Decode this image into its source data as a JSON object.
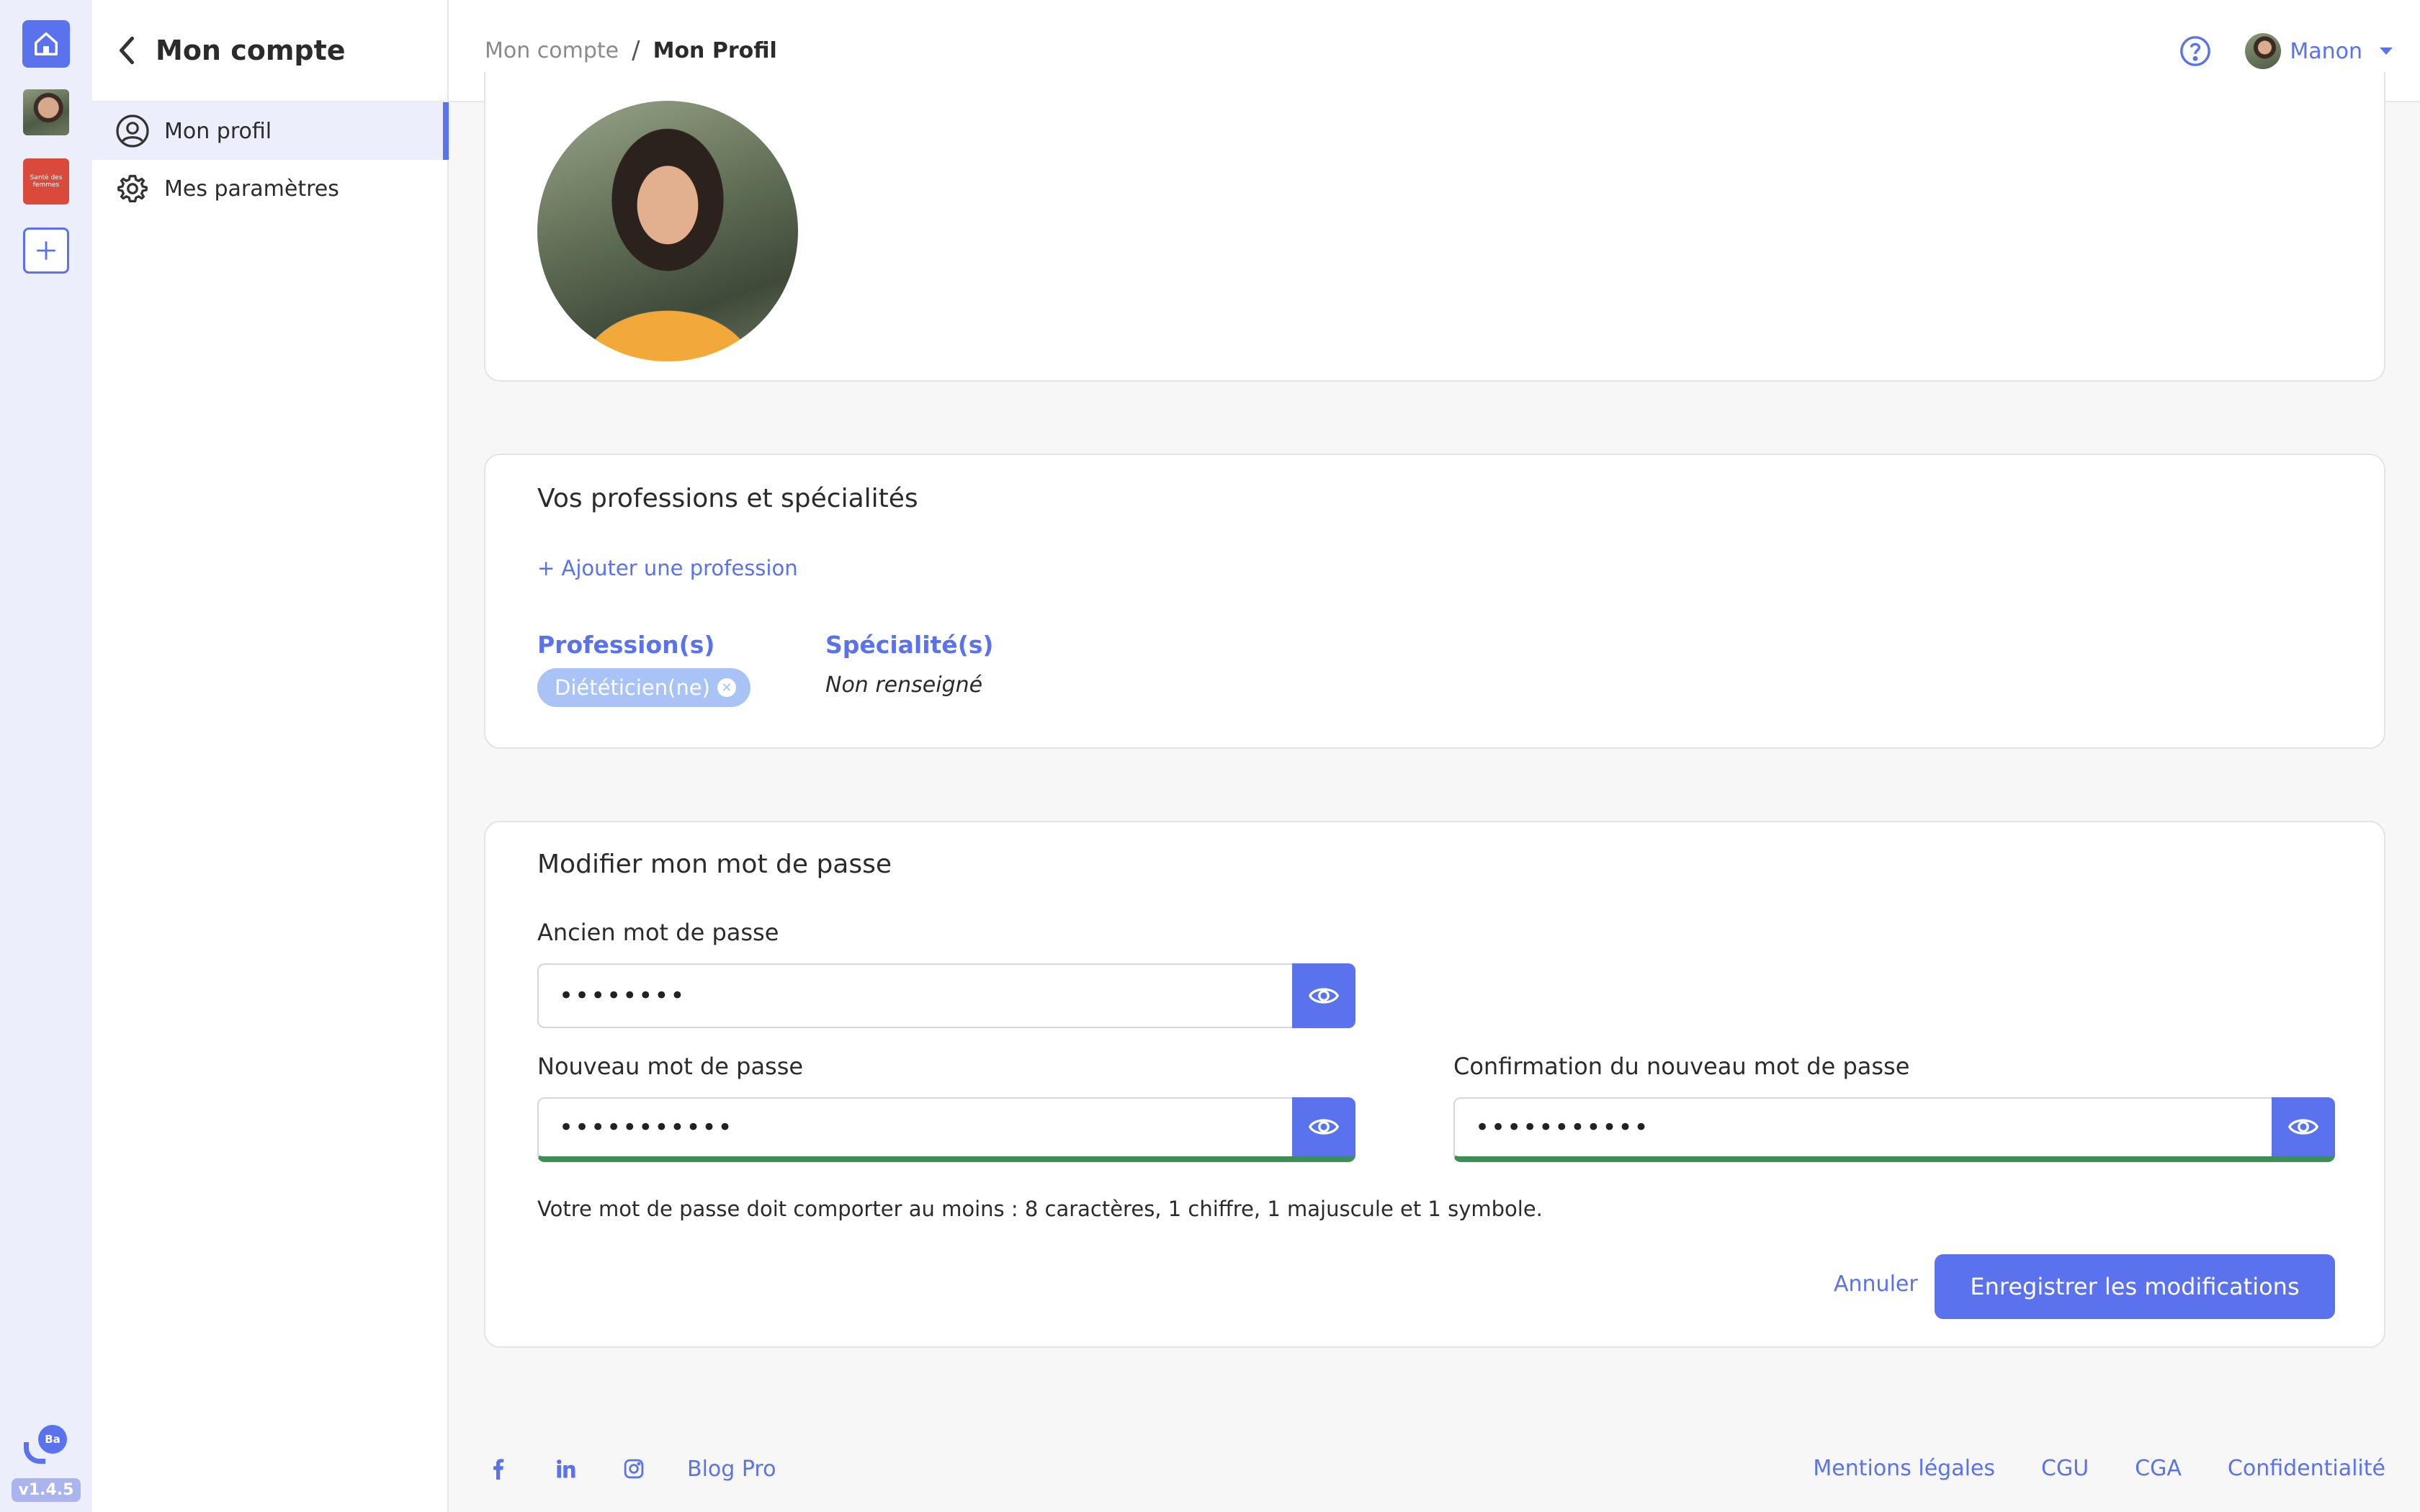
{
  "rail": {
    "brand_thumb_text": "Santé des femmes",
    "logo_text": "Ba",
    "version": "v1.4.5"
  },
  "sidebar": {
    "title": "Mon compte",
    "items": [
      {
        "label": "Mon profil",
        "icon": "user-circle-icon",
        "active": true
      },
      {
        "label": "Mes paramètres",
        "icon": "gear-icon",
        "active": false
      }
    ]
  },
  "topbar": {
    "breadcrumb_parent": "Mon compte",
    "breadcrumb_sep": "/",
    "breadcrumb_current": "Mon Profil",
    "user_name": "Manon"
  },
  "professions": {
    "title": "Vos professions et spécialités",
    "add_link": "+ Ajouter une profession",
    "profession_label": "Profession(s)",
    "profession_chip": "Diététicien(ne)",
    "specialty_label": "Spécialité(s)",
    "specialty_value": "Non renseigné"
  },
  "password": {
    "title": "Modifier mon mot de passe",
    "old_label": "Ancien mot de passe",
    "old_value": "••••••••",
    "new_label": "Nouveau mot de passe",
    "new_value": "•••••••••••",
    "confirm_label": "Confirmation du nouveau mot de passe",
    "confirm_value": "•••••••••••",
    "hint": "Votre mot de passe doit comporter au moins : 8 caractères, 1 chiffre, 1 majuscule et 1 symbole.",
    "cancel_label": "Annuler",
    "save_label": "Enregistrer les modifications"
  },
  "footer": {
    "blog_link": "Blog Pro",
    "links": [
      "Mentions légales",
      "CGU",
      "CGA",
      "Confidentialité"
    ]
  },
  "colors": {
    "accent": "#5b72ef",
    "strength_ok": "#3e8e58",
    "chip": "#a9c3f7"
  }
}
